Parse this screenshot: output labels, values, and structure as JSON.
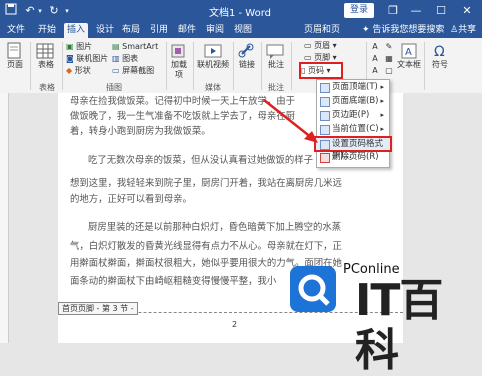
{
  "window": {
    "title": "文档1 - Word",
    "login_label": "登录",
    "controls": [
      "restore-icon",
      "minimize-icon",
      "maximize-icon",
      "close-icon"
    ]
  },
  "tabs": [
    {
      "label": "文件"
    },
    {
      "label": "开始"
    },
    {
      "label": "插入",
      "active": true
    },
    {
      "label": "设计"
    },
    {
      "label": "布局"
    },
    {
      "label": "引用"
    },
    {
      "label": "邮件"
    },
    {
      "label": "审阅"
    },
    {
      "label": "视图"
    },
    {
      "label": "页眉和页脚"
    }
  ],
  "tell_me": "告诉我您想要搜索",
  "share_label": "共享",
  "ribbon": {
    "page": "页面",
    "table": "表格",
    "group_table": "表格",
    "picture": "图片",
    "online_picture": "联机图片",
    "shapes": "形状",
    "smartart": "SmartArt",
    "chart": "图表",
    "screenshot": "屏幕截图",
    "group_illustrations": "插图",
    "addins": "加载项",
    "online_video": "联机视频",
    "group_media": "媒体",
    "links": "链接",
    "comment": "批注",
    "group_comments": "批注",
    "header": "页眉",
    "footer": "页脚",
    "page_number": "页码",
    "text_box": "文本框",
    "symbol": "符号"
  },
  "dropdown": {
    "items": [
      {
        "label": "页面顶端(T)",
        "submenu": true
      },
      {
        "label": "页面底端(B)",
        "submenu": true
      },
      {
        "label": "页边距(P)",
        "submenu": true
      },
      {
        "label": "当前位置(C)",
        "submenu": true
      },
      {
        "label": "设置页码格式(F)...",
        "submenu": false,
        "highlight": true
      },
      {
        "label": "删除页码(R)",
        "submenu": false
      }
    ]
  },
  "document": {
    "lines": [
      "母亲在捡我做饭菜。记得初中时候一天上午放学，由于",
      "做饭晚了，我一生气准备不吃饭就上学去了，母亲在厨",
      "着，转身小跑到厨房为我做饭菜。",
      "吃了无数次母亲的饭菜，但从没认真看过她做饭的样子",
      "想到这里，我轻轻来到院子里，厨房门开着，我站在离厨房几米远",
      "的地方，正好可以看到母亲。",
      "厨房里装的还是以前那种白炽灯，昏色暗黄下加上腾空的水蒸",
      "气，白炽灯散发的昏黄光线显得有点力不从心。母亲就在灯下，正",
      "用擀面杖擀面，擀面杖很粗大，她似乎要用很大的力气。面团在她",
      "面条动的擀面杖下由崎岖粗糙变得慢慢平整，我小"
    ],
    "footer_tag": "首页页脚 - 第 3 节 -",
    "page_num": "2"
  },
  "watermark": {
    "site": "PConline",
    "brand": "IT百科"
  },
  "colors": {
    "ribbon_blue": "#2b579a",
    "highlight_red": "#e02020",
    "logo_blue": "#1e73d6"
  }
}
